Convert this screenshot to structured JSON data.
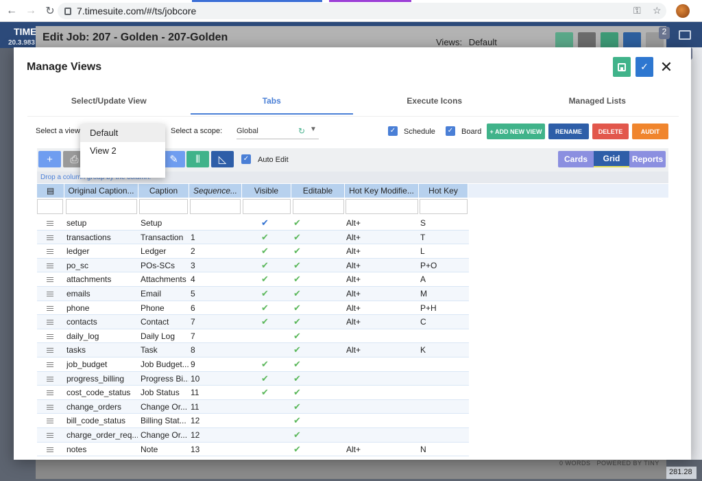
{
  "browser": {
    "url": "7.timesuite.com/#/ts/jobcore"
  },
  "app": {
    "logo": "TIME",
    "version": "20.3.983"
  },
  "edit_job": {
    "title": "Edit Job: 207 - Golden - 207-Golden",
    "views_label": "Views:",
    "views_value": "Default",
    "badge": "2",
    "footer_words": "0 WORDS",
    "footer_powered": "POWERED BY TINY",
    "footer_number": "281.28"
  },
  "modal": {
    "title": "Manage Views",
    "badge": "2",
    "tabs": [
      {
        "label": "Select/Update View",
        "active": false
      },
      {
        "label": "Tabs",
        "active": true
      },
      {
        "label": "Execute Icons",
        "active": false
      },
      {
        "label": "Managed Lists",
        "active": false
      }
    ],
    "select_view_label": "Select a view:",
    "select_scope_label": "Select a scope:",
    "scope_value": "Global",
    "schedule_label": "Schedule",
    "board_label": "Board",
    "buttons": {
      "add_new_view": "+ ADD NEW VIEW",
      "rename": "RENAME",
      "delete": "DELETE",
      "audit": "AUDIT"
    },
    "auto_edit_label": "Auto Edit",
    "segments": [
      "Cards",
      "Grid",
      "Reports"
    ],
    "drop_hint": "Drop a column                   group by the column.",
    "dropdown": [
      "Default",
      "View 2"
    ]
  },
  "colors": {
    "primary": "#4a7fd6",
    "green": "#40b38a",
    "navy": "#2e5ea8",
    "red": "#e2574c",
    "orange": "#f0852d"
  },
  "grid": {
    "columns": [
      "Original Caption...",
      "Caption",
      "Sequence...",
      "Visible",
      "Editable",
      "Hot Key Modifie...",
      "Hot Key"
    ],
    "rows": [
      {
        "orig": "setup",
        "caption": "Setup",
        "seq": "",
        "visible": "blue",
        "editable": true,
        "mod": "Alt+",
        "key": "S"
      },
      {
        "orig": "transactions",
        "caption": "Transaction",
        "seq": "1",
        "visible": "green",
        "editable": true,
        "mod": "Alt+",
        "key": "T"
      },
      {
        "orig": "ledger",
        "caption": "Ledger",
        "seq": "2",
        "visible": "green",
        "editable": true,
        "mod": "Alt+",
        "key": "L"
      },
      {
        "orig": "po_sc",
        "caption": "POs-SCs",
        "seq": "3",
        "visible": "green",
        "editable": true,
        "mod": "Alt+",
        "key": "P+O"
      },
      {
        "orig": "attachments",
        "caption": "Attachments",
        "seq": "4",
        "visible": "green",
        "editable": true,
        "mod": "Alt+",
        "key": "A"
      },
      {
        "orig": "emails",
        "caption": "Email",
        "seq": "5",
        "visible": "green",
        "editable": true,
        "mod": "Alt+",
        "key": "M"
      },
      {
        "orig": "phone",
        "caption": "Phone",
        "seq": "6",
        "visible": "green",
        "editable": true,
        "mod": "Alt+",
        "key": "P+H"
      },
      {
        "orig": "contacts",
        "caption": "Contact",
        "seq": "7",
        "visible": "green",
        "editable": true,
        "mod": "Alt+",
        "key": "C"
      },
      {
        "orig": "daily_log",
        "caption": "Daily Log",
        "seq": "7",
        "visible": "",
        "editable": true,
        "mod": "",
        "key": ""
      },
      {
        "orig": "tasks",
        "caption": "Task",
        "seq": "8",
        "visible": "",
        "editable": true,
        "mod": "Alt+",
        "key": "K"
      },
      {
        "orig": "job_budget",
        "caption": "Job Budget...",
        "seq": "9",
        "visible": "green",
        "editable": true,
        "mod": "",
        "key": ""
      },
      {
        "orig": "progress_billing",
        "caption": "Progress Bi...",
        "seq": "10",
        "visible": "green",
        "editable": true,
        "mod": "",
        "key": ""
      },
      {
        "orig": "cost_code_status",
        "caption": "Job Status",
        "seq": "11",
        "visible": "green",
        "editable": true,
        "mod": "",
        "key": ""
      },
      {
        "orig": "change_orders",
        "caption": "Change Or...",
        "seq": "11",
        "visible": "",
        "editable": true,
        "mod": "",
        "key": ""
      },
      {
        "orig": "bill_code_status",
        "caption": "Billing Stat...",
        "seq": "12",
        "visible": "",
        "editable": true,
        "mod": "",
        "key": ""
      },
      {
        "orig": "charge_order_req...",
        "caption": "Change Or...",
        "seq": "12",
        "visible": "",
        "editable": true,
        "mod": "",
        "key": ""
      },
      {
        "orig": "notes",
        "caption": "Note",
        "seq": "13",
        "visible": "",
        "editable": true,
        "mod": "Alt+",
        "key": "N"
      }
    ]
  }
}
